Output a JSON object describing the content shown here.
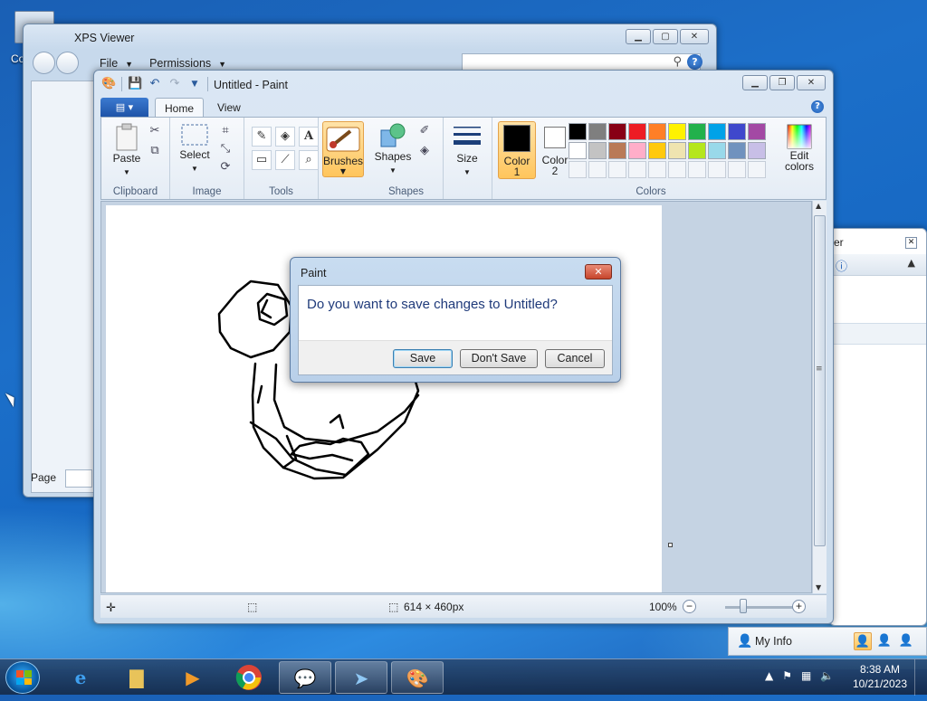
{
  "desktop": {
    "icon_label": "Co"
  },
  "xps": {
    "title": "XPS Viewer",
    "menu": [
      "File",
      "Permissions"
    ],
    "page_label": "Page"
  },
  "partial": {
    "title": "er"
  },
  "paint": {
    "title": "Untitled - Paint",
    "tabs": {
      "home": "Home",
      "view": "View"
    },
    "groups": {
      "clipboard": "Clipboard",
      "image": "Image",
      "tools": "Tools",
      "shapes": "Shapes",
      "colors": "Colors"
    },
    "buttons": {
      "paste": "Paste",
      "select": "Select",
      "brushes": "Brushes",
      "shapes": "Shapes",
      "size": "Size",
      "color1": "Color\n1",
      "color2": "Color\n2",
      "edit_colors": "Edit colors"
    },
    "palette": [
      "#000000",
      "#7f7f7f",
      "#880015",
      "#ed1c24",
      "#ff7f27",
      "#fff200",
      "#22b14c",
      "#00a2e8",
      "#3f48cc",
      "#a349a4",
      "#ffffff",
      "#c3c3c3",
      "#b97a57",
      "#ffaec9",
      "#ffc90e",
      "#efe4b0",
      "#b5e61d",
      "#99d9ea",
      "#7092be",
      "#c8bfe7"
    ],
    "color1": "#000000",
    "color2": "#ffffff",
    "status": {
      "dimensions": "614 × 460px",
      "zoom": "100%"
    }
  },
  "dialog": {
    "title": "Paint",
    "message": "Do you want to save changes to Untitled?",
    "save": "Save",
    "dont_save": "Don't Save",
    "cancel": "Cancel"
  },
  "myinfo": {
    "label": "My Info"
  },
  "taskbar": {
    "time": "8:38 AM",
    "date": "10/21/2023"
  }
}
